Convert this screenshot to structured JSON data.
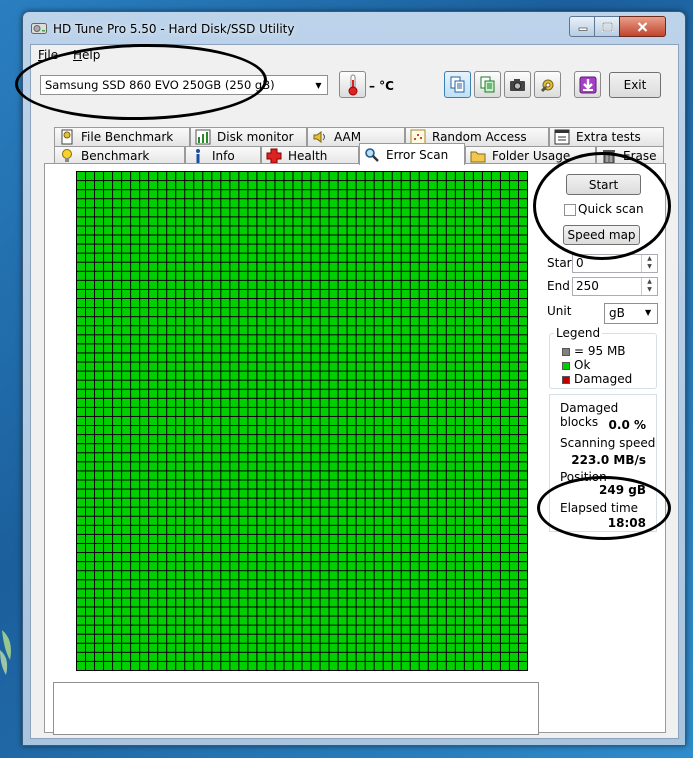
{
  "window": {
    "title": "HD Tune Pro 5.50 - Hard Disk/SSD Utility"
  },
  "menu": {
    "items": [
      "File",
      "Help"
    ]
  },
  "toolbar": {
    "drive": "Samsung SSD 860 EVO 250GB (250 gB)",
    "temperature": "– °C",
    "exit_label": "Exit"
  },
  "tabs": {
    "row1": [
      "File Benchmark",
      "Disk monitor",
      "AAM",
      "Random Access",
      "Extra tests"
    ],
    "row2": [
      "Benchmark",
      "Info",
      "Health",
      "Error Scan",
      "Folder Usage",
      "Erase"
    ],
    "selected": "Error Scan"
  },
  "error_scan": {
    "grid": {
      "cols": 50,
      "rows": 55,
      "status": "Ok",
      "color": "#00d000"
    },
    "start_label": "Start",
    "quick_scan_label": "Quick scan",
    "quick_scan_checked": false,
    "speed_map_label": "Speed map",
    "start_field_label": "Start",
    "start_value": "0",
    "end_field_label": "End",
    "end_value": "250",
    "unit_label": "Unit",
    "unit_value": "gB",
    "legend": {
      "title": "Legend",
      "items": [
        {
          "label": "= 95 MB",
          "color": "#808080"
        },
        {
          "label": "Ok",
          "color": "#00d000"
        },
        {
          "label": "Damaged",
          "color": "#c00000"
        }
      ]
    },
    "stats": {
      "damaged_blocks_label": "Damaged blocks",
      "damaged_blocks_value": "0.0 %",
      "scanning_speed_label": "Scanning speed",
      "scanning_speed_value": "223.0 MB/s",
      "position_label": "Position",
      "position_value": "249 gB",
      "elapsed_time_label": "Elapsed time",
      "elapsed_time_value": "18:08"
    }
  },
  "colors": {
    "ok_green": "#00d000",
    "damaged_red": "#c00000",
    "annotation": "#000000"
  }
}
